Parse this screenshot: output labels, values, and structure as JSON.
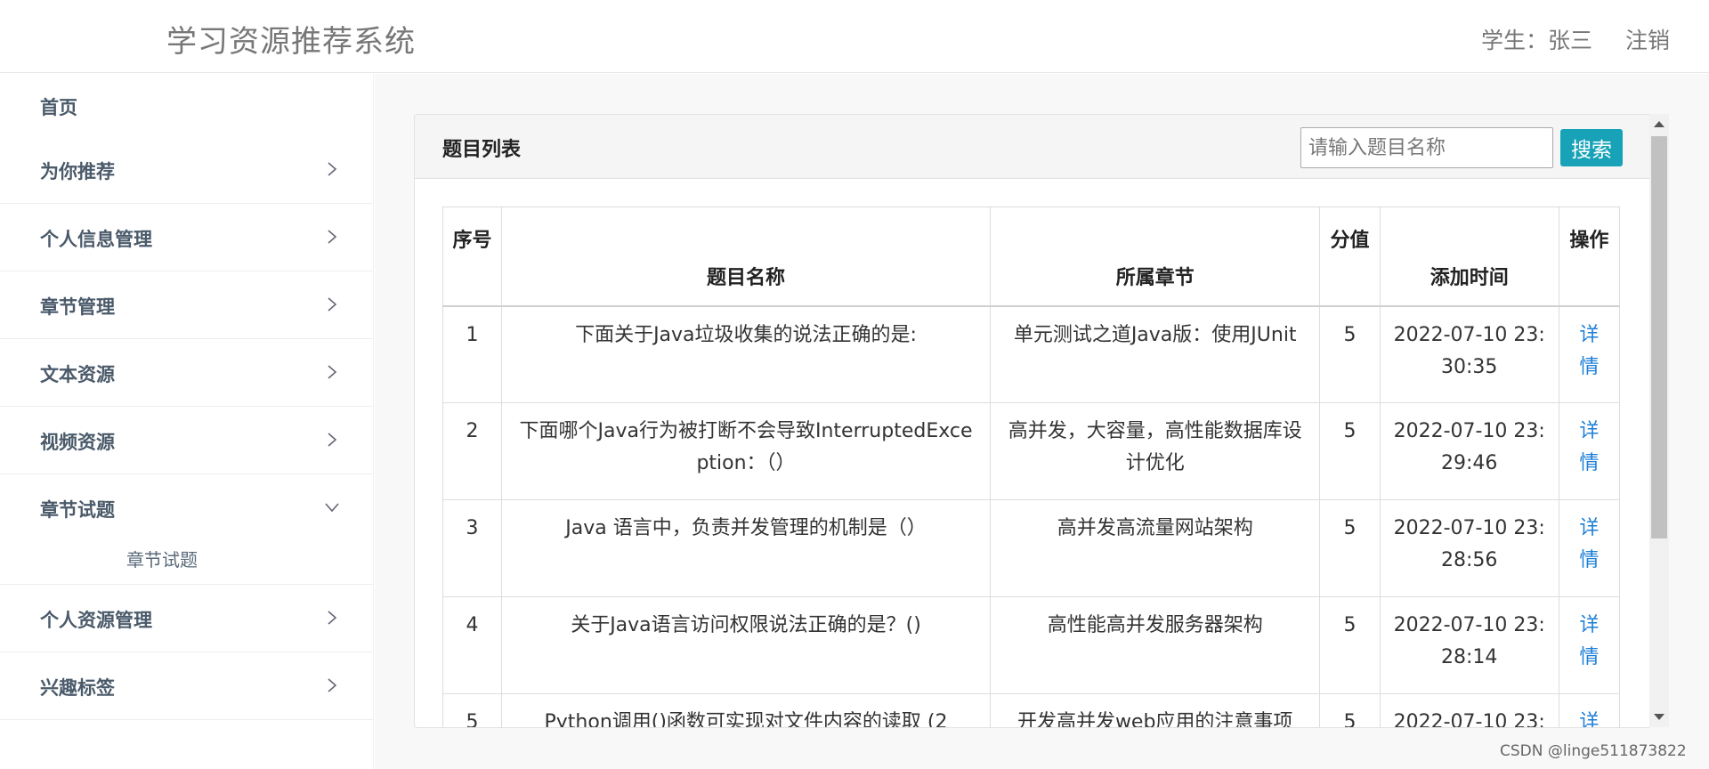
{
  "header": {
    "app_title": "学习资源推荐系统",
    "user_label": "学生：张三",
    "logout_label": "注销"
  },
  "sidebar": {
    "items": [
      {
        "label": "首页",
        "chevron": "none"
      },
      {
        "label": "为你推荐",
        "chevron": "right"
      },
      {
        "label": "个人信息管理",
        "chevron": "right"
      },
      {
        "label": "章节管理",
        "chevron": "right"
      },
      {
        "label": "文本资源",
        "chevron": "right"
      },
      {
        "label": "视频资源",
        "chevron": "right"
      },
      {
        "label": "章节试题",
        "chevron": "down",
        "expanded": true,
        "children": [
          {
            "label": "章节试题"
          }
        ]
      },
      {
        "label": "个人资源管理",
        "chevron": "right"
      },
      {
        "label": "兴趣标签",
        "chevron": "right"
      }
    ]
  },
  "panel": {
    "title": "题目列表",
    "search_placeholder": "请输入题目名称",
    "search_button": "搜索"
  },
  "table": {
    "headers": [
      "序号",
      "题目名称",
      "所属章节",
      "分值",
      "添加时间",
      "操作"
    ],
    "rows": [
      {
        "no": "1",
        "name": "下面关于Java垃圾收集的说法正确的是:",
        "chapter": "单元测试之道Java版：使用JUnit",
        "score": "5",
        "time": "2022-07-10 23:30:35",
        "action": "详情"
      },
      {
        "no": "2",
        "name": "下面哪个Java行为被打断不会导致InterruptedException：（）",
        "chapter": "高并发，大容量，高性能数据库设计优化",
        "score": "5",
        "time": "2022-07-10 23:29:46",
        "action": "详情"
      },
      {
        "no": "3",
        "name": "Java 语言中，负责并发管理的机制是（）",
        "chapter": "高并发高流量网站架构",
        "score": "5",
        "time": "2022-07-10 23:28:56",
        "action": "详情"
      },
      {
        "no": "4",
        "name": "关于Java语言访问权限说法正确的是？()",
        "chapter": "高性能高并发服务器架构",
        "score": "5",
        "time": "2022-07-10 23:28:14",
        "action": "详情"
      },
      {
        "no": "5",
        "name": "Python调用()函数可实现对文件内容的读取 (2",
        "chapter": "开发高并发web应用的注意事项",
        "score": "5",
        "time": "2022-07-10 23:",
        "action": "详"
      }
    ]
  },
  "watermark": "CSDN @linge511873822",
  "colors": {
    "accent": "#17a2b8",
    "link": "#1e7fd6",
    "sidebar_text": "#4a5a6a"
  }
}
